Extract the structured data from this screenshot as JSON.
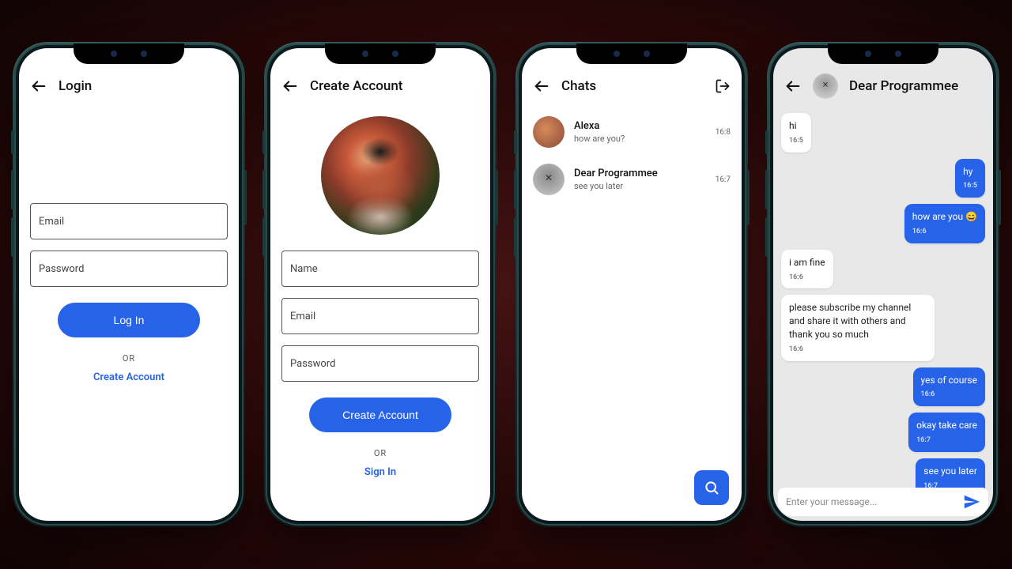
{
  "login": {
    "title": "Login",
    "email_label": "Email",
    "password_label": "Password",
    "button": "Log In",
    "or": "OR",
    "create": "Create Account"
  },
  "create": {
    "title": "Create Account",
    "name_label": "Name",
    "email_label": "Email",
    "password_label": "Password",
    "button": "Create Account",
    "or": "OR",
    "signin": "Sign In"
  },
  "chats": {
    "title": "Chats",
    "items": [
      {
        "name": "Alexa",
        "preview": "how are you?",
        "time": "16:8"
      },
      {
        "name": "Dear Programmee",
        "preview": "see you later",
        "time": "16:7"
      }
    ]
  },
  "conversation": {
    "title": "Dear Programmee",
    "compose_placeholder": "Enter your message...",
    "messages": [
      {
        "side": "in",
        "text": "hi",
        "time": "16:5"
      },
      {
        "side": "out",
        "text": "hy",
        "time": "16:5"
      },
      {
        "side": "out",
        "text": "how are you 😄",
        "time": "16:6"
      },
      {
        "side": "in",
        "text": "i am fine",
        "time": "16:6"
      },
      {
        "side": "in",
        "text": "please subscribe my channel and share it with others and thank you so much",
        "time": "16:6"
      },
      {
        "side": "out",
        "text": "yes of course",
        "time": "16:6"
      },
      {
        "side": "out",
        "text": "okay take care",
        "time": "16:7"
      },
      {
        "side": "out",
        "text": "see you later",
        "time": "16:7"
      }
    ]
  }
}
